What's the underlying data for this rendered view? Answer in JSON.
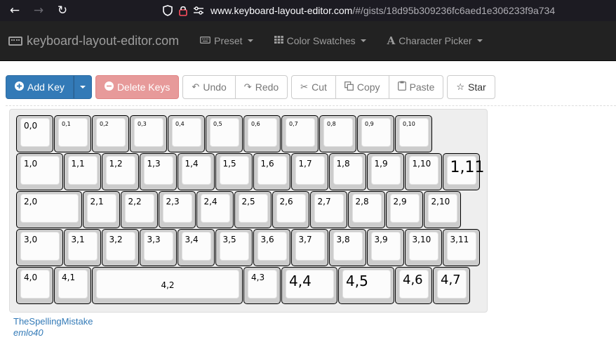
{
  "browser": {
    "back_icon": "←",
    "forward_icon": "→",
    "reload_icon": "↻",
    "url_host": "www.keyboard-layout-editor.com",
    "url_rest": "/#/gists/18d95b309236fc6aed1e306233f9a734"
  },
  "navbar": {
    "brand": "keyboard-layout-editor.com",
    "preset": "Preset",
    "color_swatches": "Color Swatches",
    "character_picker": "Character Picker"
  },
  "toolbar": {
    "add_key": "Add Key",
    "delete_keys": "Delete Keys",
    "undo": "Undo",
    "redo": "Redo",
    "cut": "Cut",
    "copy": "Copy",
    "paste": "Paste",
    "star": "Star"
  },
  "keyboard": {
    "row0": [
      "0,0",
      "0,1",
      "0,2",
      "0,3",
      "0,4",
      "0,5",
      "0,6",
      "0,7",
      "0,8",
      "0,9",
      "0,10"
    ],
    "row1": [
      "1,0",
      "1,1",
      "1,2",
      "1,3",
      "1,4",
      "1,5",
      "1,6",
      "1,7",
      "1,8",
      "1,9",
      "1,10",
      "1,11"
    ],
    "row2": [
      "2,0",
      "2,1",
      "2,2",
      "2,3",
      "2,4",
      "2,5",
      "2,6",
      "2,7",
      "2,8",
      "2,9",
      "2,10"
    ],
    "row3": [
      "3,0",
      "3,1",
      "3,2",
      "3,3",
      "3,4",
      "3,5",
      "3,6",
      "3,7",
      "3,8",
      "3,9",
      "3,10",
      "3,11"
    ],
    "row4": [
      "4,0",
      "4,1",
      "4,2",
      "4,3",
      "4,4",
      "4,5",
      "4,6",
      "4,7"
    ]
  },
  "footer": {
    "author": "TheSpellingMistake",
    "name": "emlo40"
  }
}
